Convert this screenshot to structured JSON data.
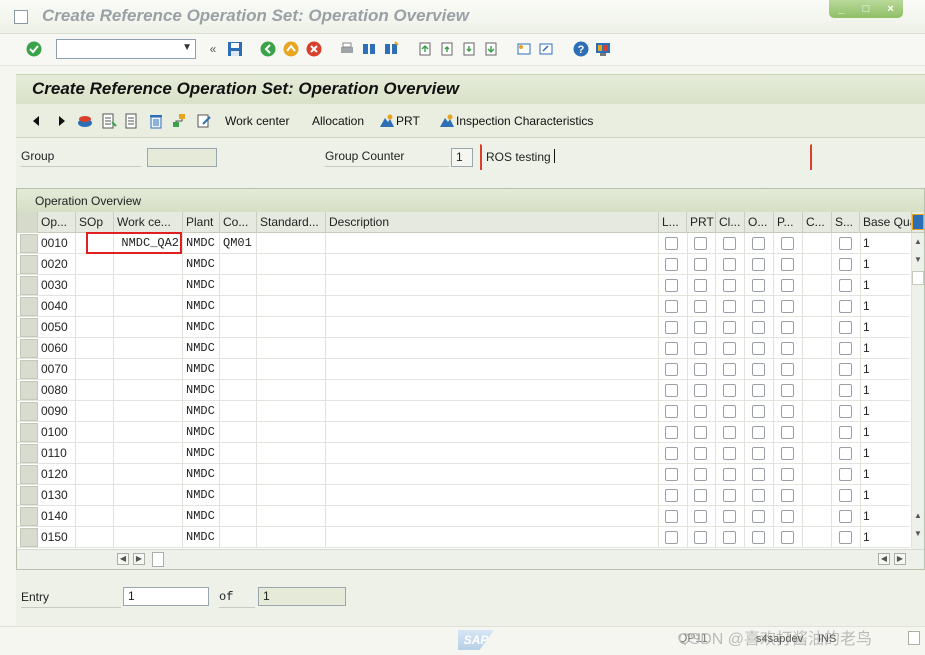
{
  "window": {
    "title": "Create Reference Operation Set: Operation Overview",
    "controls": [
      "_",
      "□",
      "×"
    ]
  },
  "system_toolbar": {
    "command_field_value": ""
  },
  "app": {
    "title": "Create Reference Operation Set: Operation Overview",
    "toolbar": {
      "work_center": "Work center",
      "allocation": "Allocation",
      "prt": "PRT",
      "inspection": "Inspection Characteristics"
    }
  },
  "header": {
    "group_label": "Group",
    "group_value": "",
    "group_counter_label": "Group Counter",
    "group_counter_value": "1",
    "description": "ROS testing"
  },
  "table": {
    "caption": "Operation Overview",
    "columns": [
      "Op...",
      "SOp",
      "Work ce...",
      "Plant",
      "Co...",
      "Standard...",
      "Description",
      "L...",
      "PRT",
      "Cl...",
      "O...",
      "P...",
      "C...",
      "S...",
      "Base Qua"
    ],
    "rows": [
      {
        "op": "0010",
        "sop": "",
        "wc": "NMDC_QA2",
        "plant": "NMDC",
        "co": "QM01",
        "base": "1"
      },
      {
        "op": "0020",
        "sop": "",
        "wc": "",
        "plant": "NMDC",
        "co": "",
        "base": "1"
      },
      {
        "op": "0030",
        "sop": "",
        "wc": "",
        "plant": "NMDC",
        "co": "",
        "base": "1"
      },
      {
        "op": "0040",
        "sop": "",
        "wc": "",
        "plant": "NMDC",
        "co": "",
        "base": "1"
      },
      {
        "op": "0050",
        "sop": "",
        "wc": "",
        "plant": "NMDC",
        "co": "",
        "base": "1"
      },
      {
        "op": "0060",
        "sop": "",
        "wc": "",
        "plant": "NMDC",
        "co": "",
        "base": "1"
      },
      {
        "op": "0070",
        "sop": "",
        "wc": "",
        "plant": "NMDC",
        "co": "",
        "base": "1"
      },
      {
        "op": "0080",
        "sop": "",
        "wc": "",
        "plant": "NMDC",
        "co": "",
        "base": "1"
      },
      {
        "op": "0090",
        "sop": "",
        "wc": "",
        "plant": "NMDC",
        "co": "",
        "base": "1"
      },
      {
        "op": "0100",
        "sop": "",
        "wc": "",
        "plant": "NMDC",
        "co": "",
        "base": "1"
      },
      {
        "op": "0110",
        "sop": "",
        "wc": "",
        "plant": "NMDC",
        "co": "",
        "base": "1"
      },
      {
        "op": "0120",
        "sop": "",
        "wc": "",
        "plant": "NMDC",
        "co": "",
        "base": "1"
      },
      {
        "op": "0130",
        "sop": "",
        "wc": "",
        "plant": "NMDC",
        "co": "",
        "base": "1"
      },
      {
        "op": "0140",
        "sop": "",
        "wc": "",
        "plant": "NMDC",
        "co": "",
        "base": "1"
      },
      {
        "op": "0150",
        "sop": "",
        "wc": "",
        "plant": "NMDC",
        "co": "",
        "base": "1"
      }
    ]
  },
  "entry": {
    "label": "Entry",
    "value": "1",
    "of_label": "of",
    "total": "1"
  },
  "status": {
    "sap_logo": "SAP",
    "transaction": "QP11",
    "watermark": "CSDN @喜欢打酱油的老鸟",
    "server": "s4sapdev",
    "mode": "INS"
  },
  "colors": {
    "highlight_border": "#e02020",
    "header_bg": "#d9e2c8",
    "winctl_green": "#8fbf66"
  }
}
